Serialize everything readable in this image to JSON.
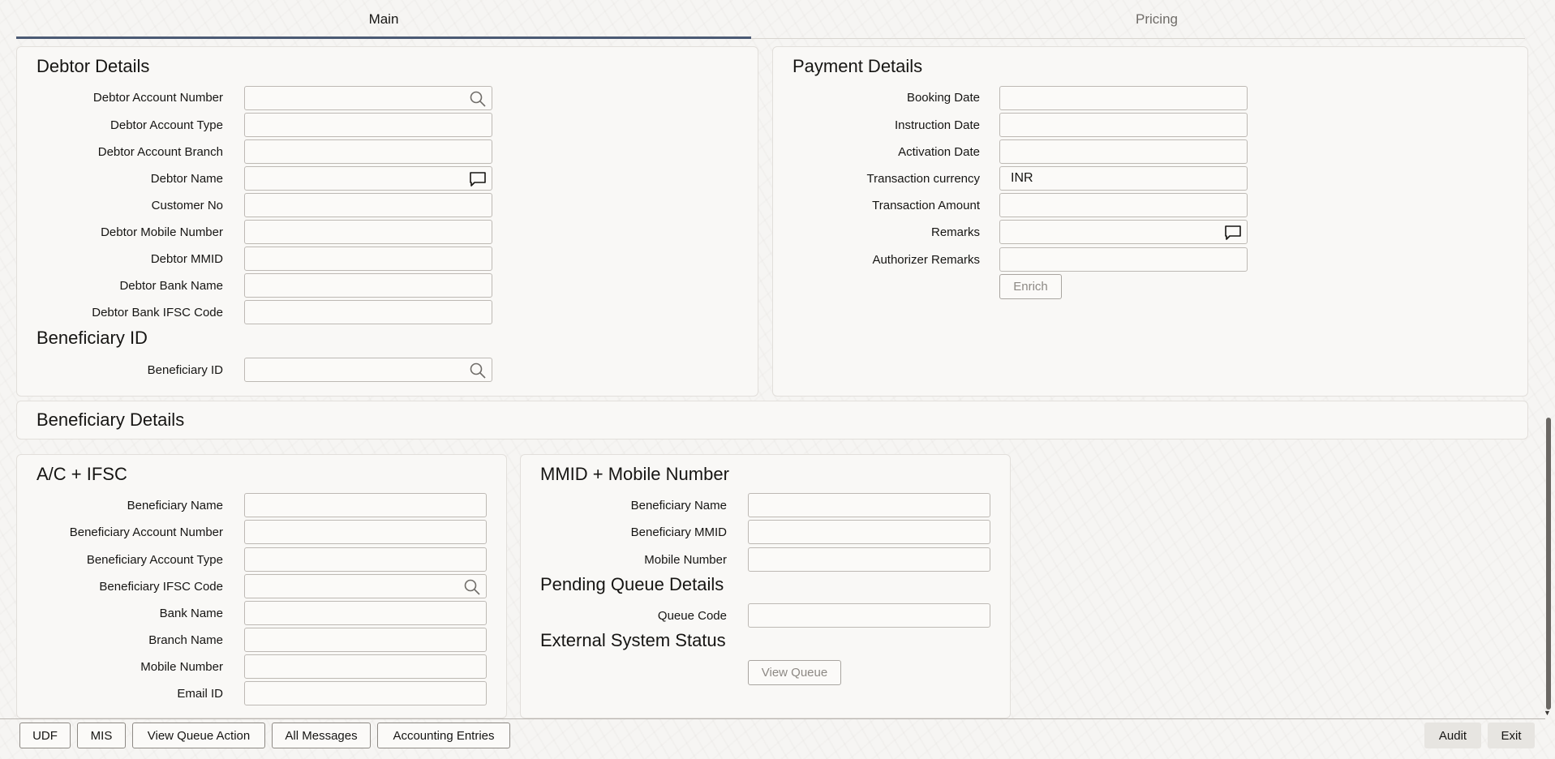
{
  "tabs": {
    "main": "Main",
    "pricing": "Pricing"
  },
  "debtor": {
    "heading": "Debtor Details",
    "account_number": "Debtor Account Number",
    "account_type": "Debtor Account Type",
    "account_branch": "Debtor Account Branch",
    "name": "Debtor Name",
    "customer_no": "Customer No",
    "mobile": "Debtor Mobile Number",
    "mmid": "Debtor MMID",
    "bank_name": "Debtor Bank Name",
    "ifsc": "Debtor Bank IFSC Code"
  },
  "beneficiary_id": {
    "heading": "Beneficiary ID",
    "label": "Beneficiary ID"
  },
  "payment": {
    "heading": "Payment Details",
    "booking_date": "Booking Date",
    "instruction_date": "Instruction Date",
    "activation_date": "Activation Date",
    "txn_currency": "Transaction currency",
    "txn_currency_value": "INR",
    "txn_amount": "Transaction Amount",
    "remarks": "Remarks",
    "authorizer_remarks": "Authorizer Remarks",
    "enrich_button": "Enrich"
  },
  "beneficiary_details": {
    "heading": "Beneficiary Details"
  },
  "ac_ifsc": {
    "heading": "A/C + IFSC",
    "ben_name": "Beneficiary Name",
    "ben_account_number": "Beneficiary Account Number",
    "ben_account_type": "Beneficiary Account Type",
    "ben_ifsc": "Beneficiary IFSC Code",
    "bank_name": "Bank Name",
    "branch_name": "Branch Name",
    "mobile": "Mobile Number",
    "email": "Email ID"
  },
  "mmid": {
    "heading": "MMID + Mobile Number",
    "ben_name": "Beneficiary Name",
    "ben_mmid": "Beneficiary MMID",
    "mobile": "Mobile Number"
  },
  "pending_queue": {
    "heading": "Pending Queue Details",
    "queue_code": "Queue Code"
  },
  "external_status": {
    "heading": "External System Status",
    "view_queue_button": "View Queue"
  },
  "footer": {
    "udf": "UDF",
    "mis": "MIS",
    "view_queue_action": "View Queue Action",
    "all_messages": "All Messages",
    "accounting_entries": "Accounting Entries",
    "audit": "Audit",
    "exit": "Exit"
  },
  "icons": {
    "search": "search-icon",
    "comment": "comment-icon"
  },
  "colors": {
    "accent": "#4b5a74",
    "panel": "#f9f8f6",
    "border": "#bdb9b4"
  }
}
